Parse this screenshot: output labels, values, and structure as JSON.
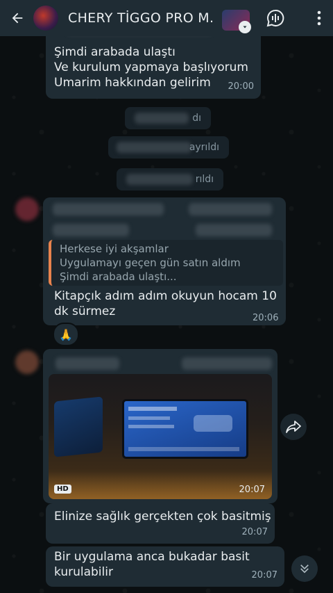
{
  "header": {
    "title": "CHERY TİGGO PRO M...",
    "back_icon": "arrow-left-icon",
    "group_thumb_icon": "chevron-down-icon",
    "chat_icon": "chat-audio-icon",
    "menu_icon": "more-vert-icon"
  },
  "messages": {
    "m1": {
      "lines": [
        "Şimdi arabada ulaştı",
        "Ve kurulum yapmaya başlıyorum",
        "Umarim hakkından gelirim"
      ],
      "time": "20:00"
    },
    "sys1": {
      "text": "dı"
    },
    "sys2": {
      "text": "ayrıldı"
    },
    "sys3": {
      "text": "rıldı"
    },
    "reply": {
      "quote_lines": [
        "Herkese iyi akşamlar",
        "Uygulamayı geçen gün satın aldım",
        "Şimdi arabada ulaştı..."
      ],
      "text_lines": [
        "Kitapçık adım adım okuyun hocam 10",
        "dk sürmez"
      ],
      "time": "20:06",
      "reaction": "🙏"
    },
    "photo_msg": {
      "badge": "HD",
      "time": "20:07"
    },
    "m4": {
      "text": "Elinize sağlık gerçekten çok basitmiş",
      "time": "20:07"
    },
    "m5": {
      "lines": [
        "Bir uygulama anca bukadar basit",
        "kurulabilir"
      ],
      "time": "20:07"
    }
  },
  "colors": {
    "bubble": "#1f2c34",
    "background": "#0b0f11",
    "quote_bar": "#e8834d",
    "timestamp": "#9fb1bb"
  }
}
